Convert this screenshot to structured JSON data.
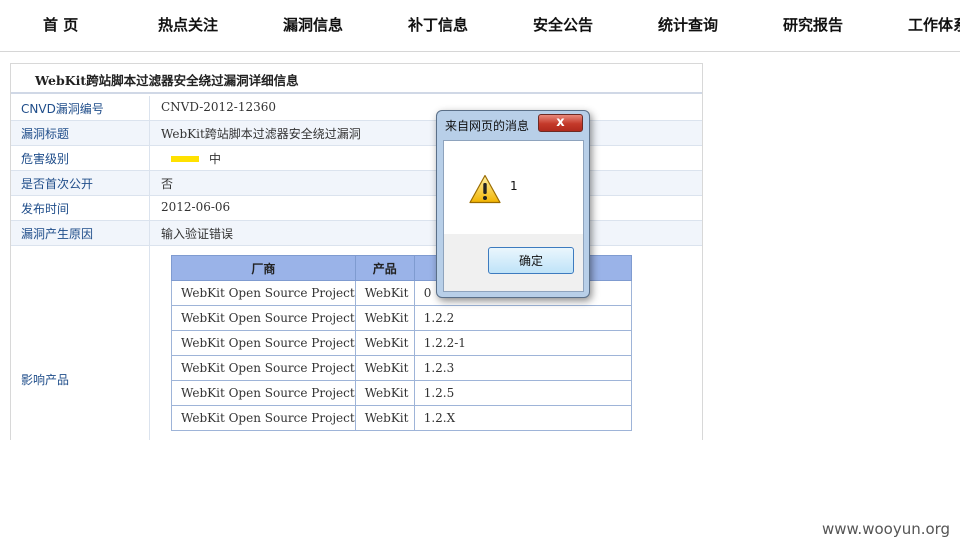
{
  "nav": {
    "items": [
      "首 页",
      "热点关注",
      "漏洞信息",
      "补丁信息",
      "安全公告",
      "统计查询",
      "研究报告",
      "工作体系"
    ]
  },
  "detail": {
    "title": "WebKit跨站脚本过滤器安全绕过漏洞详细信息",
    "rows": [
      {
        "label": "CNVD漏洞编号",
        "value": "CNVD-2012-12360"
      },
      {
        "label": "漏洞标题",
        "value": "WebKit跨站脚本过滤器安全绕过漏洞"
      },
      {
        "label": "危害级别",
        "value": "中"
      },
      {
        "label": "是否首次公开",
        "value": "否"
      },
      {
        "label": "发布时间",
        "value": "2012-06-06"
      },
      {
        "label": "漏洞产生原因",
        "value": "输入验证错误"
      }
    ],
    "severity_color": "#ffe100",
    "affected_label": "影响产品",
    "product_table": {
      "headers": [
        "厂商",
        "产品",
        ""
      ],
      "rows": [
        [
          "WebKit Open Source Project",
          "WebKit",
          "0"
        ],
        [
          "WebKit Open Source Project",
          "WebKit",
          "1.2.2"
        ],
        [
          "WebKit Open Source Project",
          "WebKit",
          "1.2.2-1"
        ],
        [
          "WebKit Open Source Project",
          "WebKit",
          "1.2.3"
        ],
        [
          "WebKit Open Source Project",
          "WebKit",
          "1.2.5"
        ],
        [
          "WebKit Open Source Project",
          "WebKit",
          "1.2.X"
        ]
      ]
    }
  },
  "dialog": {
    "title": "来自网页的消息",
    "close_glyph": "x",
    "icon": "warning-icon",
    "message": "1",
    "ok_label": "确定"
  },
  "watermark": "www.wooyun.org"
}
